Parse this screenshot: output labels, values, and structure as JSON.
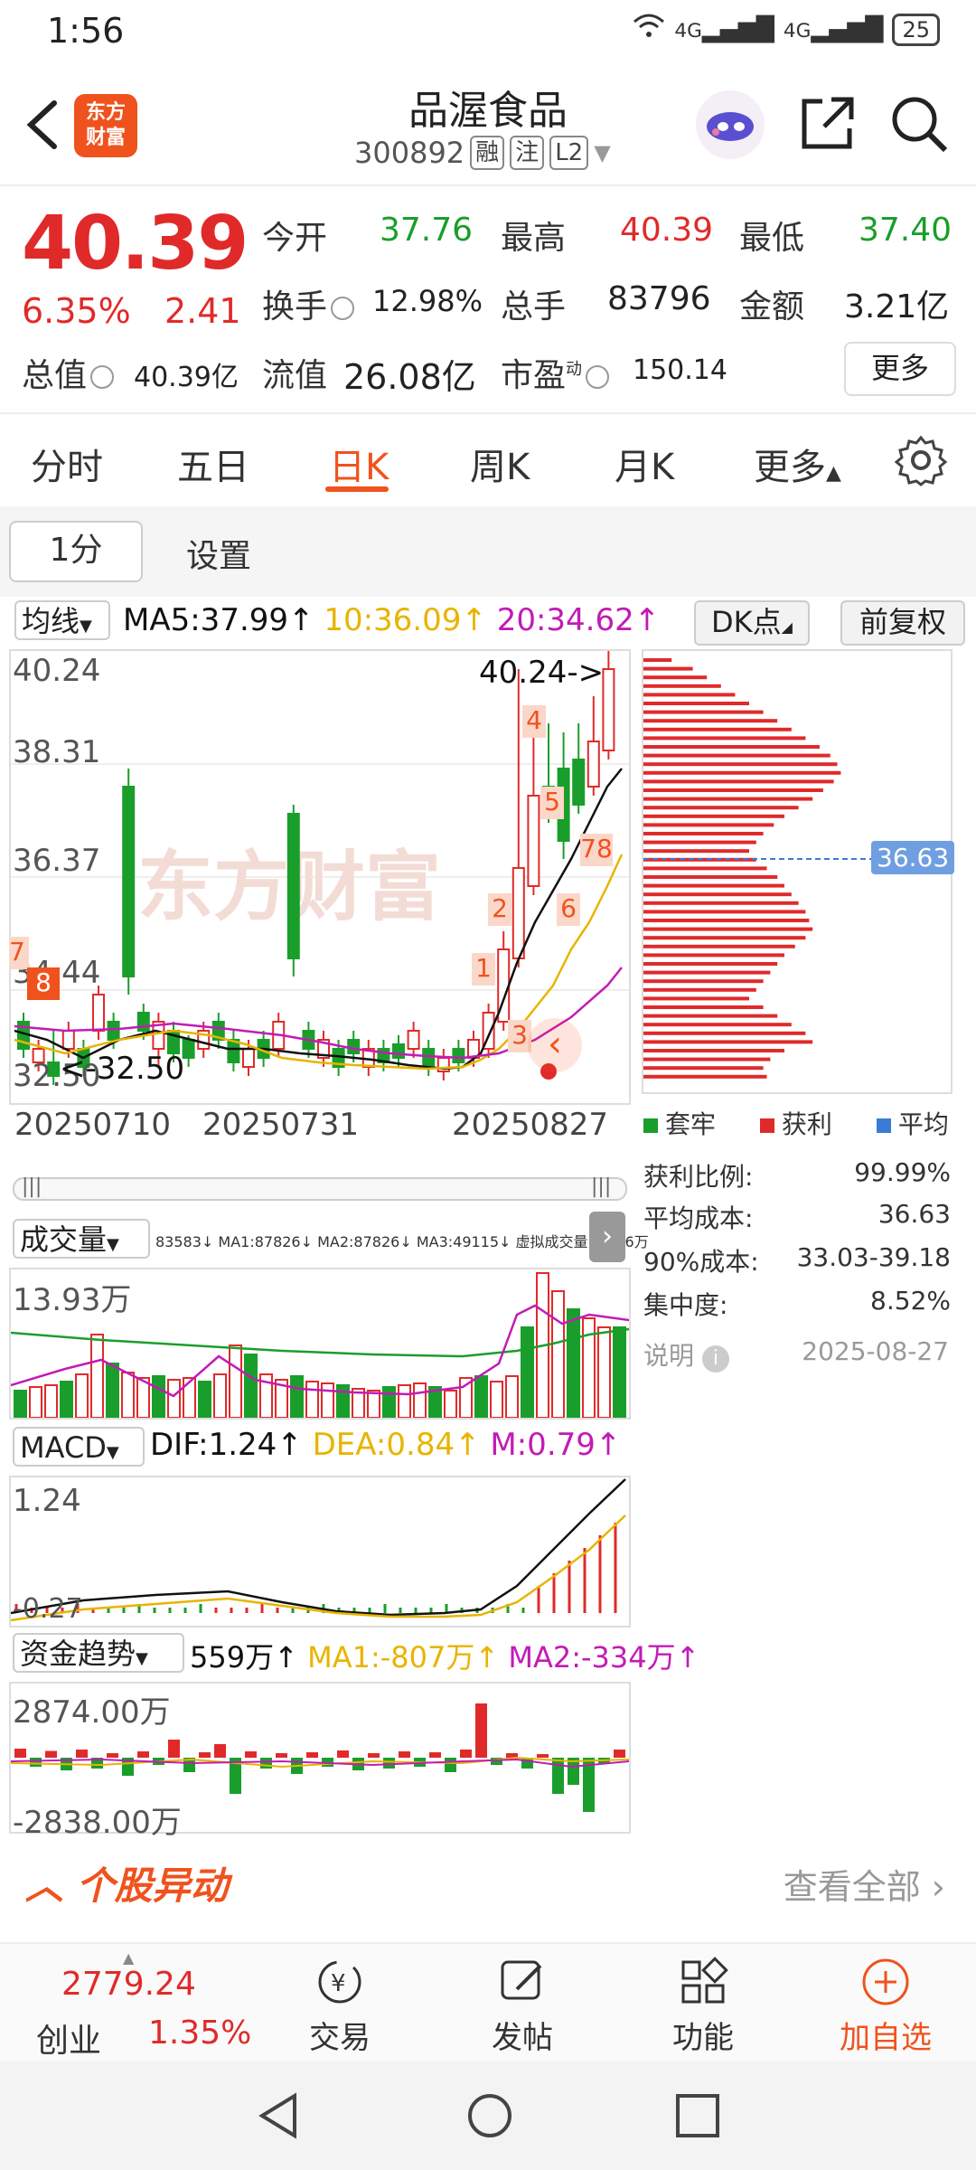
{
  "status_bar": {
    "time": "1:56",
    "signal1": "4G",
    "signal2": "4G",
    "battery": "25"
  },
  "header": {
    "stock_name": "品渥食品",
    "stock_code": "300892",
    "tags": [
      "融",
      "注",
      "L2"
    ],
    "logo_text": "东方\n财富"
  },
  "quote": {
    "price": "40.39",
    "change_pct": "6.35%",
    "change": "2.41",
    "open_label": "今开",
    "open": "37.76",
    "high_label": "最高",
    "high": "40.39",
    "low_label": "最低",
    "low": "37.40",
    "turnover_label": "换手",
    "turnover": "12.98%",
    "volume_label": "总手",
    "volume": "83796",
    "amount_label": "金额",
    "amount": "3.21亿",
    "mktcap_label": "总值",
    "mktcap": "40.39亿",
    "float_label": "流值",
    "float_cap": "26.08亿",
    "pe_label": "市盈",
    "pe_sup": "动",
    "pe": "150.14",
    "more": "更多"
  },
  "tabs": [
    "分时",
    "五日",
    "日K",
    "周K",
    "月K",
    "更多"
  ],
  "sub_buttons": {
    "interval": "1分",
    "settings": "设置"
  },
  "ma_legend": {
    "selector": "均线",
    "ma5": "MA5:37.99↑",
    "ma10": "10:36.09↑",
    "ma20": "20:34.62↑",
    "dk": "DK点",
    "fq": "前复权"
  },
  "kline": {
    "axis": [
      "40.24",
      "38.31",
      "36.37",
      "34.44",
      "32.50"
    ],
    "dates": [
      "20250710",
      "20250731",
      "20250827"
    ],
    "high_marker": "40.24->",
    "low_marker": "<-32.50",
    "watermark": "东方财富",
    "signals": [
      "4",
      "5",
      "78",
      "2",
      "6",
      "1",
      "3",
      "7",
      "8"
    ]
  },
  "chip": {
    "avg_label": "36.63",
    "legend": [
      "套牢",
      "获利",
      "平均"
    ],
    "stats": [
      {
        "label": "获利比例:",
        "value": "99.99%"
      },
      {
        "label": "平均成本:",
        "value": "36.63"
      },
      {
        "label": "90%成本:",
        "value": "33.03-39.18"
      },
      {
        "label": "集中度:",
        "value": "8.52%"
      }
    ],
    "note_label": "说明",
    "date": "2025-08-27"
  },
  "volume_panel": {
    "selector": "成交量",
    "legend": "83583↓ MA1:87826↓ MA2:87826↓ MA3:49115↓ 虚拟成交量:10.36万",
    "max": "13.93万"
  },
  "macd_panel": {
    "selector": "MACD",
    "dif": "DIF:1.24↑",
    "dea": "DEA:0.84↑",
    "m": "M:0.79↑",
    "top": "1.24",
    "bottom": "-0.27"
  },
  "fund_panel": {
    "selector": "资金趋势",
    "v": "559万↑",
    "ma1": "MA1:-807万↑",
    "ma2": "MA2:-334万↑",
    "top": "2874.00万",
    "bottom": "-2838.00万"
  },
  "alert": {
    "title": "个股异动",
    "view_all": "查看全部"
  },
  "bottom_nav": {
    "index_value": "2779.24",
    "index_name": "创业",
    "index_pct": "1.35%",
    "items": [
      "交易",
      "发帖",
      "功能",
      "加自选"
    ]
  },
  "colors": {
    "up": "#e02a2a",
    "down": "#1a9e2b",
    "accent": "#f0521e",
    "ma10": "#e8b400",
    "ma20": "#c21bb6"
  }
}
